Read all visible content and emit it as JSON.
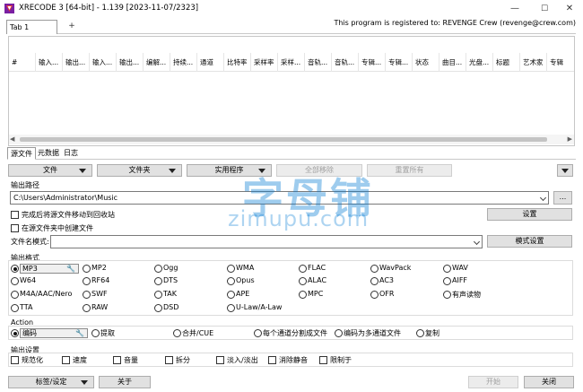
{
  "titlebar": {
    "title": "XRECODE 3 [64-bit] - 1.139 [2023-11-07/2323]",
    "minimize": "—",
    "maximize": "☐",
    "close": "✕"
  },
  "registration": "This program is registered to: REVENGE Crew (revenge@crew.com)",
  "doc_tabs": {
    "tab1": "Tab 1",
    "add": "+"
  },
  "grid": {
    "columns": [
      "#",
      "输入...",
      "输出...",
      "输入...",
      "输出...",
      "编解...",
      "持续...",
      "通道",
      "比特率",
      "采样率",
      "采样...",
      "音轨...",
      "音轨...",
      "专辑...",
      "专辑...",
      "状态",
      "曲目...",
      "光盘...",
      "标题",
      "艺术家",
      "专辑"
    ]
  },
  "sub_tabs": [
    "源文件",
    "元数据",
    "日志"
  ],
  "toolbar": {
    "file": "文件",
    "folder": "文件夹",
    "utilities": "实用程序",
    "remove_all": "全部移除",
    "reset_all": "重置所有"
  },
  "output_path": {
    "label": "输出路径",
    "value": "C:\\Users\\Administrator\\Music",
    "browse": "...",
    "move_source": "完成后将源文件移动到回收站",
    "settings": "设置",
    "create_in_source": "在源文件夹中创建文件",
    "filename_pattern_label": "文件名模式:",
    "filename_pattern_value": "",
    "pattern_settings": "模式设置"
  },
  "output_format": {
    "label": "输出格式",
    "selected": "MP3",
    "formats": [
      [
        "MP3",
        "MP2",
        "Ogg",
        "WMA",
        "FLAC",
        "WavPack",
        "WAV"
      ],
      [
        "W64",
        "RF64",
        "DTS",
        "Opus",
        "ALAC",
        "AC3",
        "AIFF"
      ],
      [
        "M4A/AAC/Nero",
        "SWF",
        "TAK",
        "APE",
        "MPC",
        "OFR",
        "有声读物"
      ],
      [
        "TTA",
        "RAW",
        "DSD",
        "U-Law/A-Law"
      ]
    ]
  },
  "action": {
    "label": "Action",
    "selected": "编码",
    "options": [
      "编码",
      "提取",
      "合并/CUE",
      "每个通道分割成文件",
      "编码为多通道文件",
      "复制"
    ]
  },
  "output_settings": {
    "label": "输出设置",
    "options": [
      "规范化",
      "速度",
      "音量",
      "拆分",
      "淡入/淡出",
      "消除静音",
      "限制于"
    ]
  },
  "bottom": {
    "tags_settings": "标签/设定",
    "about": "关于",
    "start": "开始",
    "close": "关闭"
  },
  "watermark": {
    "cn": "字母铺",
    "url": "zimupu.com"
  },
  "colors": {
    "watermark": "#0078d2",
    "button_face": "#e1e1e1",
    "border": "#adadad"
  }
}
